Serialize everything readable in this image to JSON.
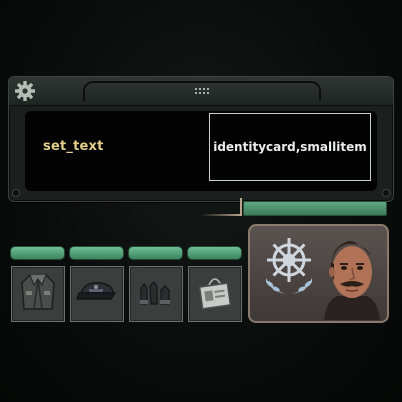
{
  "editor_panel": {
    "field_label": "set_text",
    "field_value": "identitycard,smallitem"
  },
  "status_bars": {
    "levels": [
      1,
      1,
      1,
      1
    ]
  },
  "inventory": {
    "slots": [
      {
        "item": "jacket-icon"
      },
      {
        "item": "cap-icon"
      },
      {
        "item": "gloves-icon"
      },
      {
        "item": "id-card-icon"
      }
    ]
  },
  "character": {
    "emblem": "ship-wheel-emblem-icon"
  },
  "colors": {
    "bar_green": "#5ea880",
    "label_yellow": "#e3cf8c",
    "panel_dark": "#1b201e"
  }
}
